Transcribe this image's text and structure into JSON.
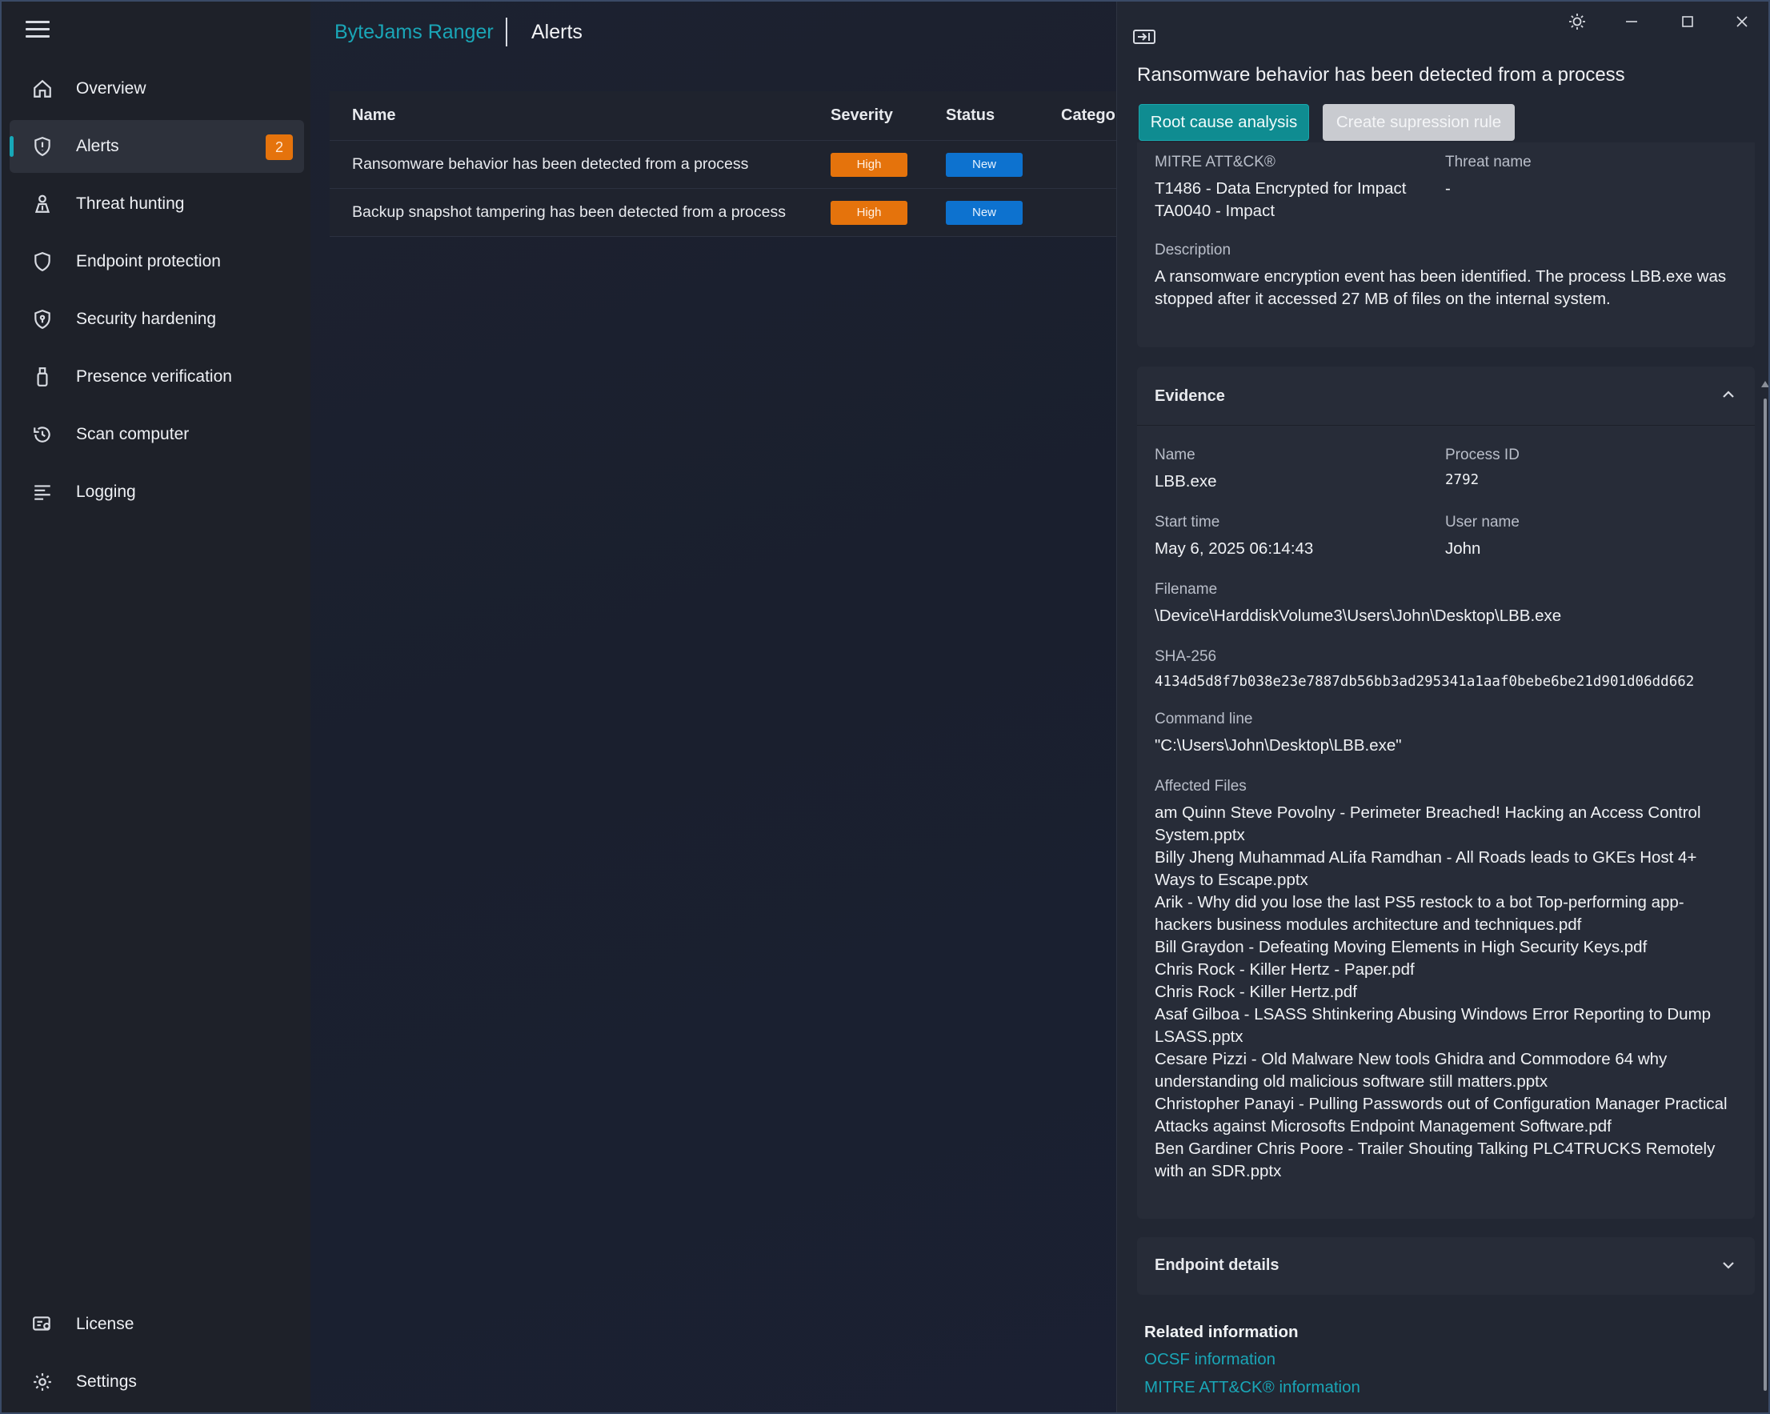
{
  "app": {
    "name": "ByteJams Ranger",
    "page": "Alerts"
  },
  "colors": {
    "accent": "#1aa6b7",
    "high": "#e5730c",
    "new": "#0d72cf",
    "badge": "#e5730c"
  },
  "sidebar": {
    "items": [
      {
        "label": "Overview",
        "icon": "home-icon"
      },
      {
        "label": "Alerts",
        "icon": "shield-alert-icon",
        "badge": "2"
      },
      {
        "label": "Threat hunting",
        "icon": "person-hunt-icon"
      },
      {
        "label": "Endpoint protection",
        "icon": "shield-icon"
      },
      {
        "label": "Security hardening",
        "icon": "shield-lock-icon"
      },
      {
        "label": "Presence verification",
        "icon": "usb-stick-icon"
      },
      {
        "label": "Scan computer",
        "icon": "history-icon"
      },
      {
        "label": "Logging",
        "icon": "list-icon"
      }
    ],
    "bottom": [
      {
        "label": "License",
        "icon": "license-icon"
      },
      {
        "label": "Settings",
        "icon": "gear-icon"
      }
    ]
  },
  "table": {
    "headers": {
      "name": "Name",
      "severity": "Severity",
      "status": "Status",
      "category": "Categor"
    },
    "rows": [
      {
        "name": "Ransomware behavior has been detected from a process",
        "severity": "High",
        "status": "New"
      },
      {
        "name": "Backup snapshot tampering has been detected from a process",
        "severity": "High",
        "status": "New"
      }
    ]
  },
  "detail": {
    "title": "Ransomware behavior has been detected from a process",
    "buttons": {
      "root_cause": "Root cause analysis",
      "suppression": "Create supression rule"
    },
    "mitre": {
      "label": "MITRE ATT&CK®",
      "technique": "T1486 - Data Encrypted for Impact",
      "tactic": "TA0040 - Impact",
      "threat_label": "Threat name",
      "threat_value": "-",
      "description_label": "Description",
      "description_line1": "A ransomware encryption event has been identified. The process LBB.exe was",
      "description_line2": "stopped after it accessed 27 MB of files on the internal system."
    },
    "evidence": {
      "title": "Evidence",
      "name_label": "Name",
      "name_value": "LBB.exe",
      "pid_label": "Process ID",
      "pid_value": "2792",
      "start_label": "Start time",
      "start_value": "May 6, 2025 06:14:43",
      "user_label": "User name",
      "user_value": "John",
      "filename_label": "Filename",
      "filename_value": "\\Device\\HarddiskVolume3\\Users\\John\\Desktop\\LBB.exe",
      "sha_label": "SHA-256",
      "sha_value": "4134d5d8f7b038e23e7887db56bb3ad295341a1aaf0bebe6be21d901d06dd662",
      "cmd_label": "Command line",
      "cmd_value": "\"C:\\Users\\John\\Desktop\\LBB.exe\"",
      "files_label": "Affected Files",
      "files_lines": [
        "am Quinn   Steve Povolny - Perimeter Breached! Hacking an Access Control",
        "System.pptx",
        "Billy Jheng   Muhammad ALifa Ramdhan - All Roads leads to GKEs Host  4+",
        "Ways to Escape.pptx",
        "Arik - Why did you lose the last PS5 restock to a bot Top-performing app-",
        "hackers business modules architecture and techniques.pdf",
        "Bill Graydon - Defeating Moving Elements in High Security Keys.pdf",
        "Chris Rock - Killer Hertz - Paper.pdf",
        "Chris Rock - Killer Hertz.pdf",
        "Asaf Gilboa - LSASS Shtinkering Abusing Windows Error Reporting to Dump",
        "LSASS.pptx",
        "Cesare Pizzi - Old Malware New tools Ghidra and Commodore 64 why",
        "understanding old malicious software still matters.pptx",
        "Christopher Panayi - Pulling Passwords out of Configuration Manager Practical",
        "Attacks against Microsofts Endpoint Management Software.pdf",
        "Ben Gardiner   Chris Poore - Trailer Shouting Talking PLC4TRUCKS Remotely",
        "with an SDR.pptx"
      ]
    },
    "endpoint": {
      "title": "Endpoint details"
    },
    "related": {
      "title": "Related information",
      "ocsf": "OCSF information",
      "mitre": "MITRE ATT&CK® information"
    }
  }
}
